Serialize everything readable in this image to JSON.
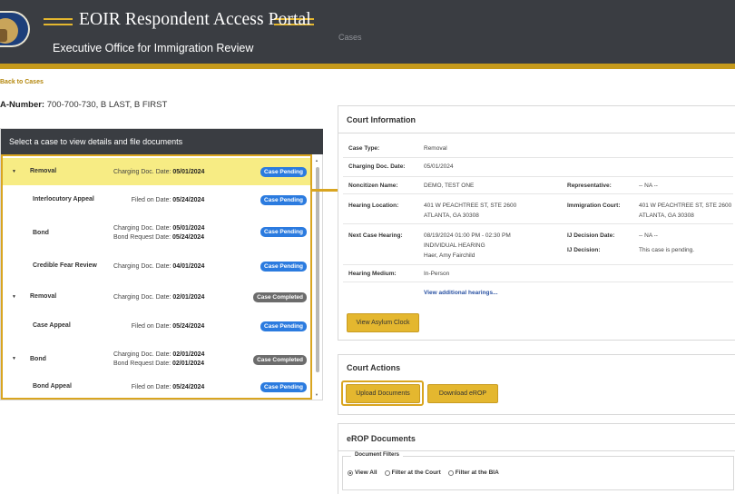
{
  "header": {
    "title": "EOIR Respondent Access Portal",
    "subtitle": "Executive Office for Immigration Review",
    "nav_cases": "Cases"
  },
  "back_link": "Back to Cases",
  "a_number": {
    "label": "A-Number:",
    "value": "700-700-730, B LAST, B FIRST"
  },
  "cases_panel": {
    "heading": "Select a case to view details and file documents",
    "rows": [
      {
        "name": "Removal",
        "line1_label": "Charging Doc. Date: ",
        "line1_value": "05/01/2024",
        "status": "Case Pending"
      },
      {
        "name": "Interlocutory Appeal",
        "line1_label": "Filed on Date: ",
        "line1_value": "05/24/2024",
        "status": "Case Pending"
      },
      {
        "name": "Bond",
        "line1_label": "Charging Doc. Date: ",
        "line1_value": "05/01/2024",
        "line2_label": "Bond Request Date: ",
        "line2_value": "05/24/2024",
        "status": "Case Pending"
      },
      {
        "name": "Credible Fear Review",
        "line1_label": "Charging Doc. Date: ",
        "line1_value": "04/01/2024",
        "status": "Case Pending"
      },
      {
        "name": "Removal",
        "line1_label": "Charging Doc. Date: ",
        "line1_value": "02/01/2024",
        "status": "Case Completed"
      },
      {
        "name": "Case Appeal",
        "line1_label": "Filed on Date: ",
        "line1_value": "05/24/2024",
        "status": "Case Pending"
      },
      {
        "name": "Bond",
        "line1_label": "Charging Doc. Date: ",
        "line1_value": "02/01/2024",
        "line2_label": "Bond Request Date: ",
        "line2_value": "02/01/2024",
        "status": "Case Completed"
      },
      {
        "name": "Bond Appeal",
        "line1_label": "Filed on Date: ",
        "line1_value": "05/24/2024",
        "status": "Case Pending"
      }
    ]
  },
  "court_info": {
    "title": "Court Information",
    "case_type_label": "Case Type:",
    "case_type_value": "Removal",
    "charging_label": "Charging Doc. Date:",
    "charging_value": "05/01/2024",
    "noncitizen_label": "Noncitizen Name:",
    "noncitizen_value": "DEMO, TEST ONE",
    "rep_label": "Representative:",
    "rep_value": "-- NA --",
    "hearing_loc_label": "Hearing Location:",
    "hearing_loc_line1": "401 W PEACHTREE ST, STE 2600",
    "hearing_loc_line2": "ATLANTA, GA 30308",
    "imm_court_label": "Immigration Court:",
    "imm_court_line1": "401 W PEACHTREE ST, STE 2600",
    "imm_court_line2": "ATLANTA, GA 30308",
    "next_hearing_label": "Next Case Hearing:",
    "next_hearing_line1": "08/19/2024   01:00 PM - 02:30 PM",
    "next_hearing_line2": "INDIVIDUAL HEARING",
    "next_hearing_line3": "Haer, Amy Fairchild",
    "udec_date_label": "IJ Decision Date:",
    "udec_date_value": "-- NA --",
    "udec_label": "IJ Decision:",
    "udec_value": "This case is pending.",
    "medium_label": "Hearing Medium:",
    "medium_value": "In-Person",
    "more_link": "View additional hearings...",
    "asylum_btn": "View Asylum Clock"
  },
  "court_actions": {
    "title": "Court Actions",
    "upload_btn": "Upload Documents",
    "download_btn": "Download eROP"
  },
  "erop": {
    "title": "eROP Documents",
    "filters_legend": "Document Filters",
    "opt_all": "View All",
    "opt_court": "Filter at the Court",
    "opt_bia": "Filter at the BIA"
  },
  "colors": {
    "header_bg": "#3a3d42",
    "accent_gold": "#e4b72f",
    "highlight_border": "#d9a520",
    "selected_row": "#f7ec84",
    "pending_badge": "#2b7bdf",
    "completed_badge": "#6c6c6c",
    "link": "#2a52a3"
  }
}
